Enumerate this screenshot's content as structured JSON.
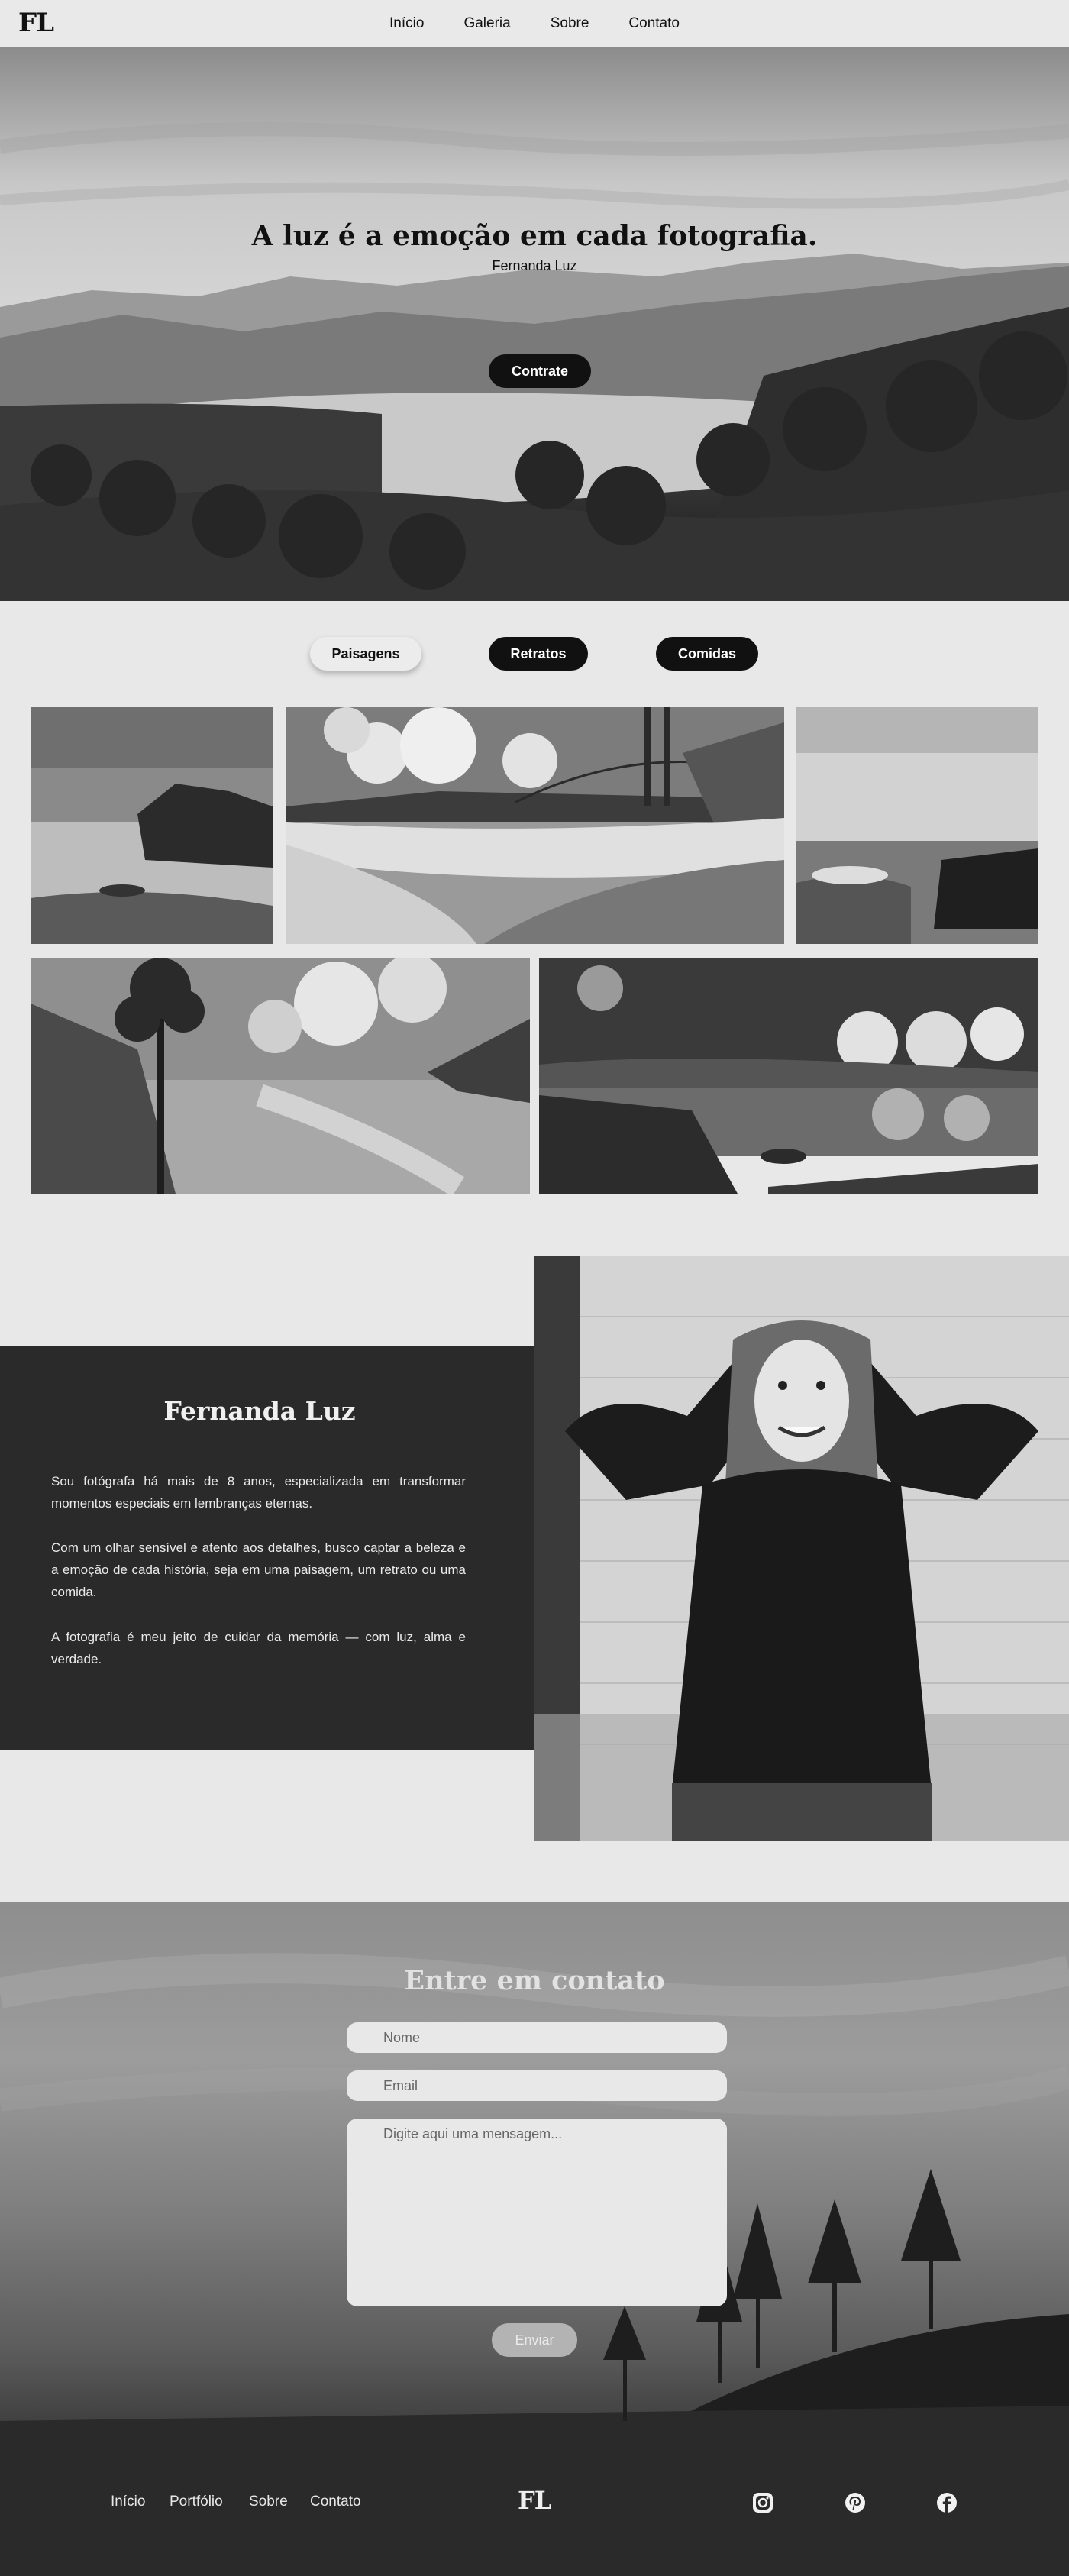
{
  "nav": {
    "logo": "FL",
    "links": [
      "Início",
      "Galeria",
      "Sobre",
      "Contato"
    ]
  },
  "hero": {
    "title": "A luz é a emoção em cada fotografia.",
    "subtitle": "Fernanda Luz",
    "cta": "Contrate"
  },
  "gallery": {
    "filters": [
      "Paisagens",
      "Retratos",
      "Comidas"
    ],
    "active_filter": "Paisagens"
  },
  "about": {
    "name": "Fernanda Luz",
    "paragraphs": [
      "Sou fotógrafa há mais de 8 anos, especializada em transformar momentos especiais em lembranças eternas.",
      "Com um olhar sensível e atento aos detalhes, busco captar a beleza e a emoção de cada história, seja em uma paisagem, um retrato ou uma comida.",
      "A fotografia é meu jeito de cuidar da memória — com luz, alma e verdade."
    ]
  },
  "contact": {
    "title": "Entre em contato",
    "name_placeholder": "Nome",
    "email_placeholder": "Email",
    "message_placeholder": "Digite aqui uma mensagem...",
    "send": "Enviar"
  },
  "footer": {
    "links": [
      "Início",
      "Portfólio",
      "Sobre",
      "Contato"
    ],
    "logo": "FL",
    "social_icons": [
      "instagram-icon",
      "pinterest-icon",
      "facebook-icon"
    ]
  },
  "colors": {
    "page_bg": "#e8e8e8",
    "dark": "#2a2a2a",
    "button": "#111111"
  }
}
